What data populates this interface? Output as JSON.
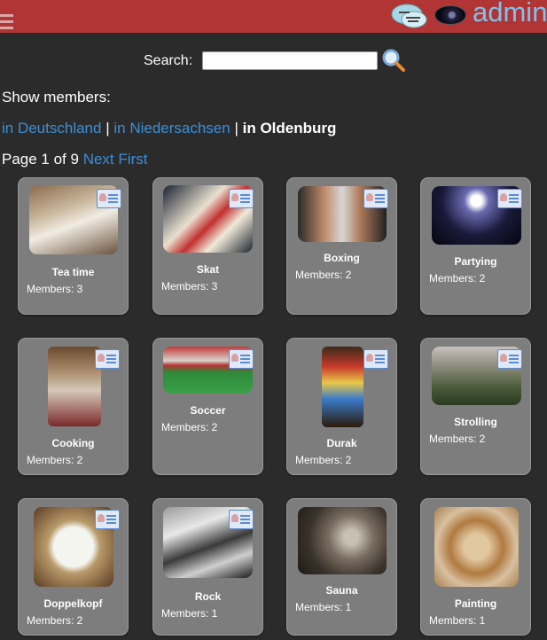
{
  "header": {
    "username": "admin"
  },
  "search": {
    "label": "Search:",
    "value": ""
  },
  "show_members_label": "Show members:",
  "locations": {
    "country": "in Deutschland",
    "sep1": "|",
    "state": "in Niedersachsen",
    "sep2": "|",
    "city": "in Oldenburg"
  },
  "pager": {
    "page_text": "Page 1 of 9",
    "next": "Next",
    "first": "First"
  },
  "groups": [
    {
      "name": "Tea time",
      "members": "Members: 3"
    },
    {
      "name": "Skat",
      "members": "Members: 3"
    },
    {
      "name": "Boxing",
      "members": "Members: 2"
    },
    {
      "name": "Partying",
      "members": "Members: 2"
    },
    {
      "name": "Cooking",
      "members": "Members: 2"
    },
    {
      "name": "Soccer",
      "members": "Members: 2"
    },
    {
      "name": "Durak",
      "members": "Members: 2"
    },
    {
      "name": "Strolling",
      "members": "Members: 2"
    },
    {
      "name": "Doppelkopf",
      "members": "Members: 2"
    },
    {
      "name": "Rock",
      "members": "Members: 1"
    },
    {
      "name": "Sauna",
      "members": "Members: 1"
    },
    {
      "name": "Painting",
      "members": "Members: 1"
    }
  ]
}
